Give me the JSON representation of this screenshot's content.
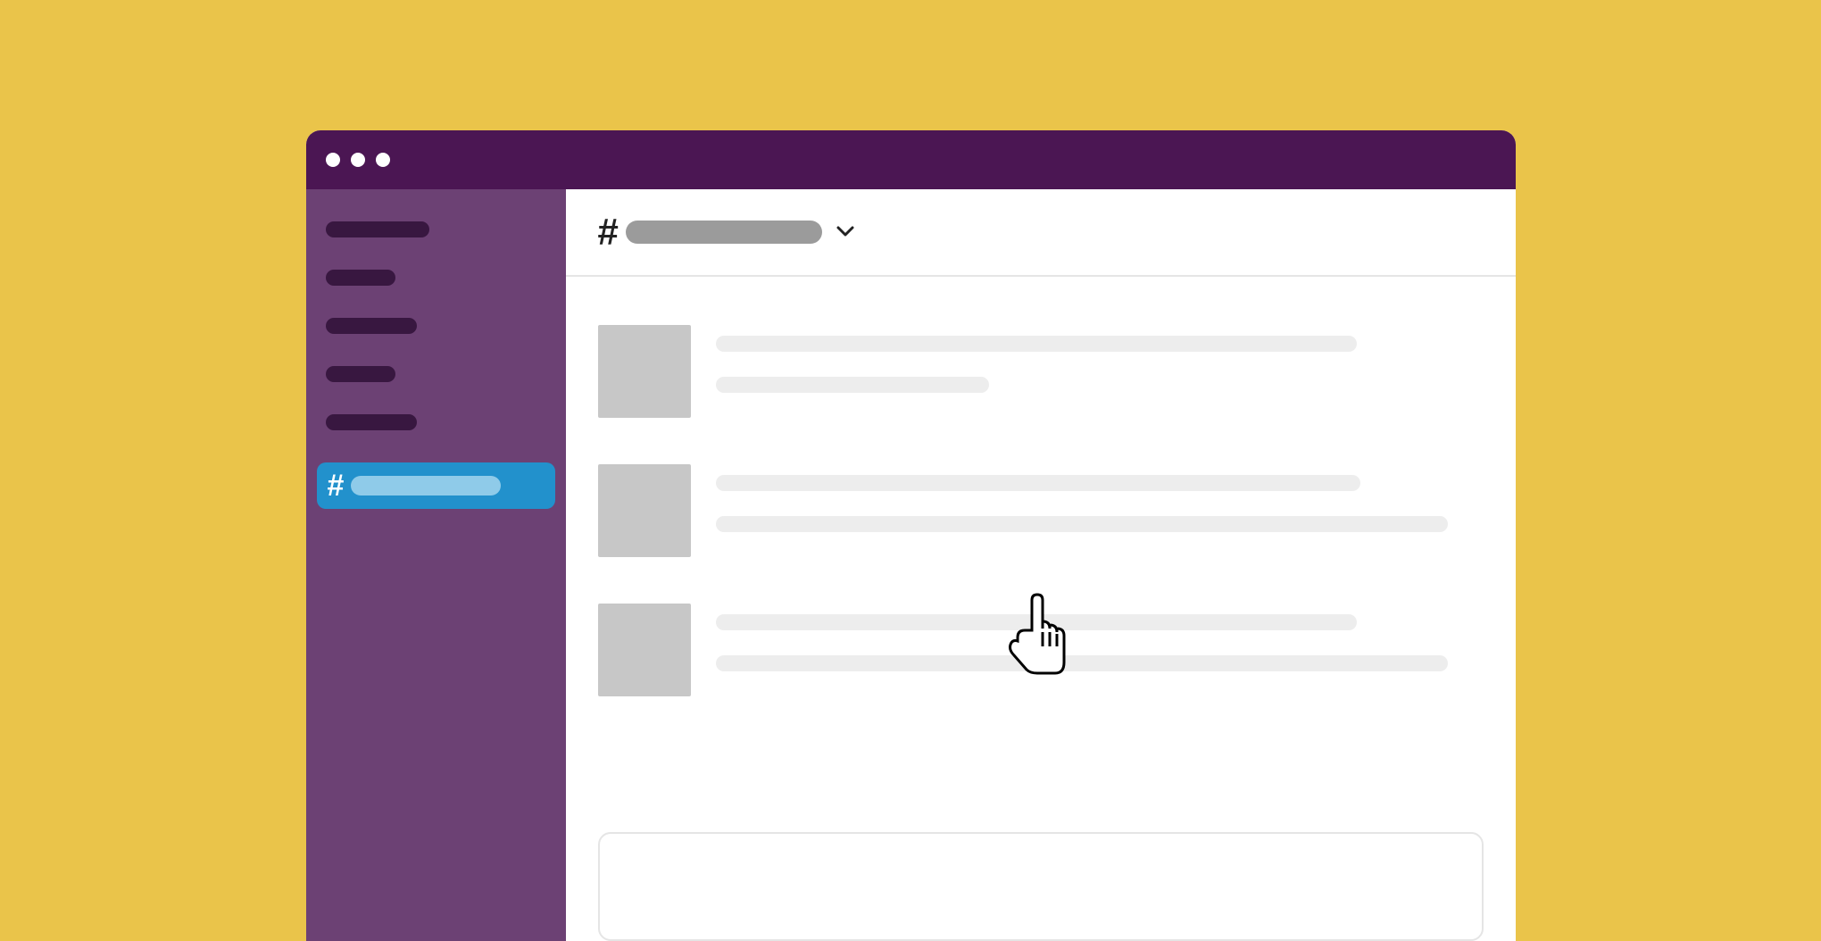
{
  "titlebar": {
    "dots": 3
  },
  "sidebar": {
    "nav_widths": [
      116,
      78,
      102,
      78,
      102
    ],
    "selected_channel": {
      "symbol": "#",
      "label": ""
    }
  },
  "header": {
    "symbol": "#",
    "label": "",
    "chevron": "chevron-down"
  },
  "messages": [
    {
      "line_widths": [
        718,
        306
      ]
    },
    {
      "line_widths": [
        722,
        820
      ]
    },
    {
      "line_widths": [
        718,
        820
      ]
    }
  ],
  "composer": {
    "placeholder": ""
  }
}
